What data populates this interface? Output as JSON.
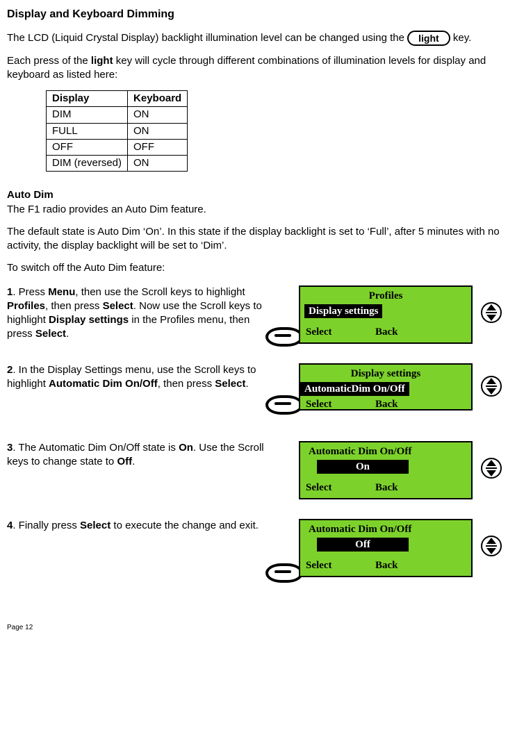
{
  "title": "Display and Keyboard Dimming",
  "intro1_pre": "The LCD (Liquid Crystal Display) backlight illumination level can be changed using the ",
  "intro1_post": " key.",
  "key_label": "light",
  "intro2a": "Each press of the ",
  "intro2_key": "light",
  "intro2b": " key will cycle through different combinations of illumination levels for display and keyboard as listed here:",
  "table": {
    "h1": "Display",
    "h2": "Keyboard",
    "rows": [
      [
        "DIM",
        "ON"
      ],
      [
        "FULL",
        "ON"
      ],
      [
        "OFF",
        "OFF"
      ],
      [
        "DIM (reversed)",
        "ON"
      ]
    ]
  },
  "autodim_head": "Auto Dim",
  "autodim_p1": "The F1 radio provides an Auto Dim feature.",
  "autodim_p2": "The default state is Auto Dim ‘On’. In this state if the display backlight is set to ‘Full’, after 5 minutes with no activity, the display backlight will be set to ‘Dim’.",
  "autodim_p3": "To switch off the Auto Dim feature:",
  "steps": {
    "s1": {
      "n": "1",
      "a": ". Press ",
      "b1": "Menu",
      "c1": ", then use the Scroll keys to highlight  ",
      "b2": "Profiles",
      "c2": ", then press ",
      "b3": "Select",
      "c3": ". Now use the Scroll keys to highlight ",
      "b4": "Display settings",
      "c4": " in the Profiles menu, then press ",
      "b5": "Select",
      "c5": "."
    },
    "s2": {
      "n": "2",
      "a": ". In the Display Settings menu, use the Scroll keys to highlight ",
      "b1": "Automatic Dim On/Off",
      "c1": ", then press ",
      "b2": "Select",
      "c2": "."
    },
    "s3": {
      "n": "3",
      "a": ". The Automatic Dim On/Off state is ",
      "b1": "On",
      "c1": ". Use the Scroll keys to change state to ",
      "b2": "Off",
      "c2": "."
    },
    "s4": {
      "n": "4",
      "a": ". Finally press ",
      "b1": "Select",
      "c1": " to execute the change and exit."
    }
  },
  "lcd": {
    "s1": {
      "title": "Profiles",
      "hi": "Display settings",
      "left": "Select",
      "right": "Back"
    },
    "s2": {
      "title": "Display settings",
      "hi": "AutomaticDim On/Off",
      "left": "Select",
      "right": "Back"
    },
    "s3": {
      "title": "Automatic Dim On/Off",
      "hi": "On",
      "left": "Select",
      "right": "Back"
    },
    "s4": {
      "title": "Automatic Dim On/Off",
      "hi": "Off",
      "left": "Select",
      "right": "Back"
    }
  },
  "page": "Page 12"
}
